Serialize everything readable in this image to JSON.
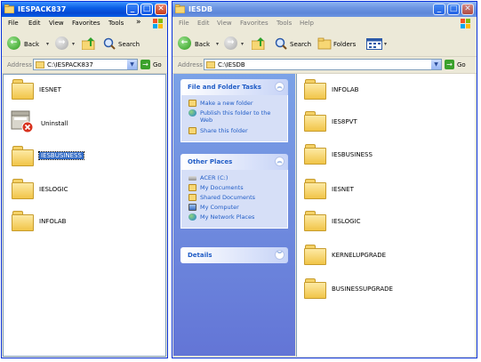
{
  "left_window": {
    "title": "IESPACK837",
    "menu": [
      "File",
      "Edit",
      "View",
      "Favorites",
      "Tools"
    ],
    "menu_more": "»",
    "toolbar": {
      "back": "Back",
      "search": "Search"
    },
    "address_label": "Address",
    "address_value": "C:\\IESPACK837",
    "go_label": "Go",
    "items": [
      {
        "label": "IESNET",
        "icon": "folder-icon"
      },
      {
        "label": "Uninstall",
        "icon": "uninstall-icon"
      },
      {
        "label": "IESBUSINESS",
        "icon": "folder-icon",
        "selected": true
      },
      {
        "label": "IESLOGIC",
        "icon": "folder-icon"
      },
      {
        "label": "INFOLAB",
        "icon": "folder-icon"
      }
    ]
  },
  "right_window": {
    "title": "IESDB",
    "menu": [
      "File",
      "Edit",
      "View",
      "Favorites",
      "Tools",
      "Help"
    ],
    "toolbar": {
      "back": "Back",
      "search": "Search",
      "folders": "Folders"
    },
    "address_label": "Address",
    "address_value": "C:\\IESDB",
    "go_label": "Go",
    "tasks_panel": {
      "title": "File and Folder Tasks",
      "links": [
        "Make a new folder",
        "Publish this folder to the Web",
        "Share this folder"
      ]
    },
    "places_panel": {
      "title": "Other Places",
      "links": [
        "ACER (C:)",
        "My Documents",
        "Shared Documents",
        "My Computer",
        "My Network Places"
      ]
    },
    "details_panel": {
      "title": "Details"
    },
    "items": [
      "INFOLAB",
      "IES8PVT",
      "IESBUSINESS",
      "IESNET",
      "IESLOGIC",
      "KERNELUPGRADE",
      "BUSINESSUPGRADE"
    ]
  },
  "colors": {
    "title_blue": "#0a5fe6",
    "close_red": "#c63c1c",
    "task_pane": "#6375d6",
    "link_blue": "#215dc6",
    "folder_yellow": "#f1c548"
  }
}
